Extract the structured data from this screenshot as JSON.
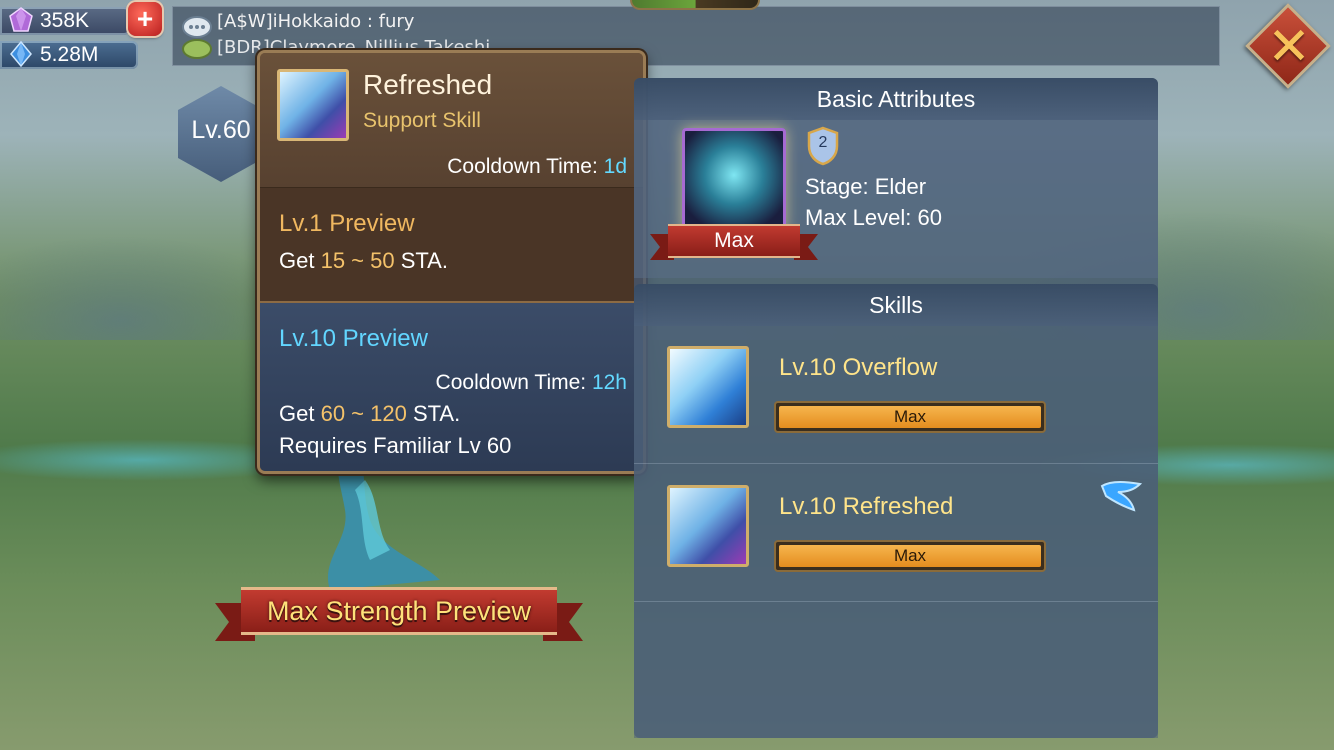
{
  "resources": {
    "gems": "358K",
    "might": "5.28M",
    "add_label": "+"
  },
  "chat": {
    "line1": "[A$W]iHokkaido : fury",
    "line2": "[BDR]Claymore_Nillius Takeshi..."
  },
  "close_label": "✕",
  "familiar": {
    "level": "Lv.60",
    "preview_button": "Max Strength Preview"
  },
  "tooltip": {
    "title": "Refreshed",
    "subtitle": "Support Skill",
    "cooldown_label": "Cooldown Time: ",
    "cooldown_value": "1d",
    "lv1": {
      "title": "Lv.1 Preview",
      "get_prefix": "Get ",
      "amount": "15 ~ 50",
      "get_suffix": " STA."
    },
    "lv10": {
      "title": "Lv.10 Preview",
      "cooldown_label": "Cooldown Time: ",
      "cooldown_value": "12h",
      "get_prefix": "Get ",
      "amount": "60 ~ 120",
      "get_suffix": " STA.",
      "requirement": "Requires Familiar Lv 60"
    }
  },
  "panel": {
    "basic_header": "Basic Attributes",
    "max_label": "Max",
    "stage_badge": "2",
    "stage": "Stage: Elder",
    "max_level": "Max Level: 60",
    "skills_header": "Skills",
    "skills": [
      {
        "name": "Lv.10 Overflow",
        "bar_label": "Max",
        "progress": 1.0
      },
      {
        "name": "Lv.10 Refreshed",
        "bar_label": "Max",
        "progress": 1.0
      }
    ]
  },
  "colors": {
    "gold": "#e8c36d",
    "cyan": "#63d9ff",
    "ribbon_red": "#c23b30",
    "bar_orange": "#f6b54d"
  },
  "icons": [
    "gem-icon",
    "crystal-icon",
    "chat-bubble-icon",
    "close-icon",
    "stage-shield-icon",
    "pin-icon"
  ]
}
